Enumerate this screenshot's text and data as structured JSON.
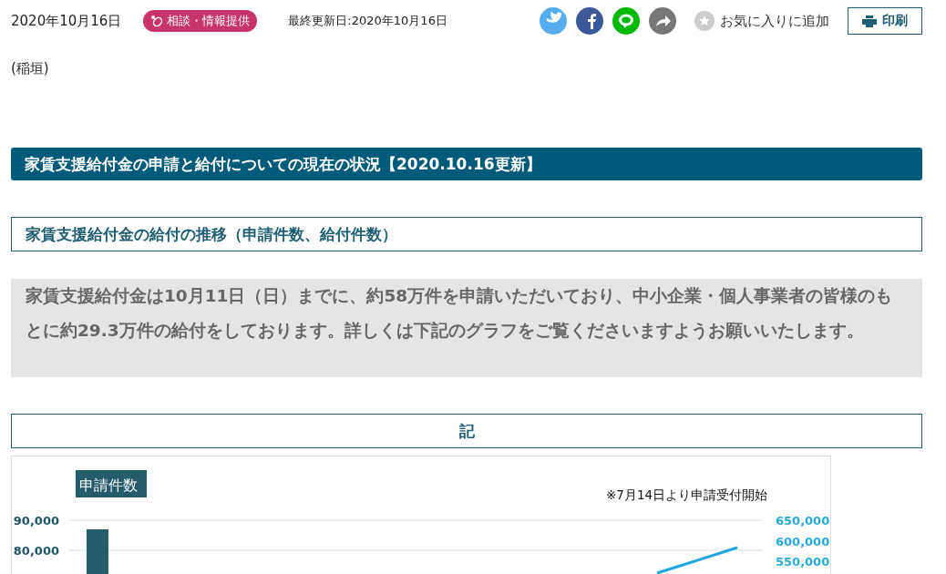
{
  "header": {
    "date": "2020年10月16日",
    "category": {
      "label": "相談・情報提供"
    },
    "updated": "最終更新日:2020年10月16日",
    "share_buttons": [
      {
        "kind": "twitter"
      },
      {
        "kind": "facebook"
      },
      {
        "kind": "line"
      },
      {
        "kind": "share"
      }
    ],
    "favorite": {
      "label": "お気に入りに追加"
    },
    "print_button": {
      "label": "印刷"
    }
  },
  "author": "(稲垣)",
  "section_heading": "家賃支援給付金の申請と給付についての現在の状況【2020.10.16更新】",
  "subheading": "家賃支援給付金の給付の推移（申請件数、給付件数）",
  "summary": "家賃支援給付金は10月11日（日）までに、約58万件を申請いただいており、中小企業・個人事業者の皆様のもとに約29.3万件の給付をしております。詳しくは下記のグラフをご覧くださいますようお願いいたします。",
  "notice_heading": "記",
  "chart": {
    "title": "申請件数",
    "annotation": "※7月14日より申請受付開始",
    "left_axis_ticks": [
      "90,000",
      "80,000"
    ],
    "right_axis_ticks": [
      "650,000",
      "600,000",
      "550,000"
    ]
  }
}
